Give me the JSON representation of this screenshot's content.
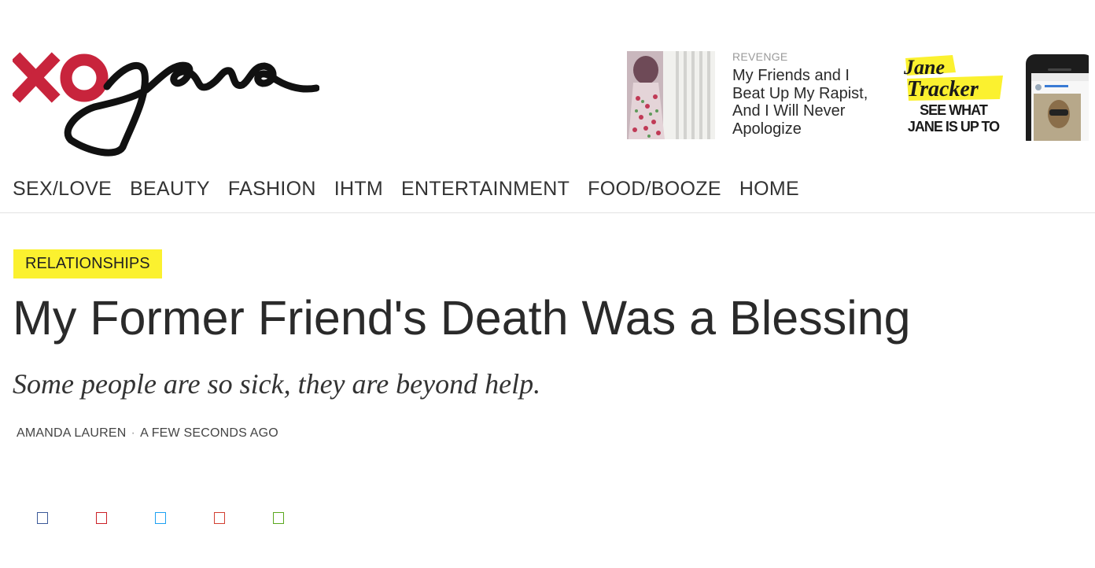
{
  "site": {
    "logo_text": "xojane"
  },
  "promo": {
    "kicker": "REVENGE",
    "title": "My Friends and I Beat Up My Rapist, And I Will Never Apologize"
  },
  "tracker": {
    "title_line1": "Jane",
    "title_line2": "Tracker",
    "sub_line1": "SEE WHAT",
    "sub_line2": "JANE IS UP TO"
  },
  "nav": {
    "items": [
      "SEX/LOVE",
      "BEAUTY",
      "FASHION",
      "IHTM",
      "ENTERTAINMENT",
      "FOOD/BOOZE",
      "HOME"
    ]
  },
  "article": {
    "category": "RELATIONSHIPS",
    "headline": "My Former Friend's Death Was a Blessing",
    "dek": "Some people are so sick, they are beyond help.",
    "author": "AMANDA LAUREN",
    "separator": "·",
    "time": "A FEW SECONDS AGO"
  },
  "share": {
    "buttons": [
      {
        "name": "facebook-share-icon",
        "color": "#3b5998"
      },
      {
        "name": "pinterest-share-icon",
        "color": "#cb2027"
      },
      {
        "name": "twitter-share-icon",
        "color": "#1da1f2"
      },
      {
        "name": "email-share-icon",
        "color": "#d23f31"
      },
      {
        "name": "comment-share-icon",
        "color": "#5aa81e"
      }
    ]
  },
  "colors": {
    "brand_red": "#c8243c",
    "category_yellow": "#fbf12f",
    "text": "#2a2a2a"
  }
}
